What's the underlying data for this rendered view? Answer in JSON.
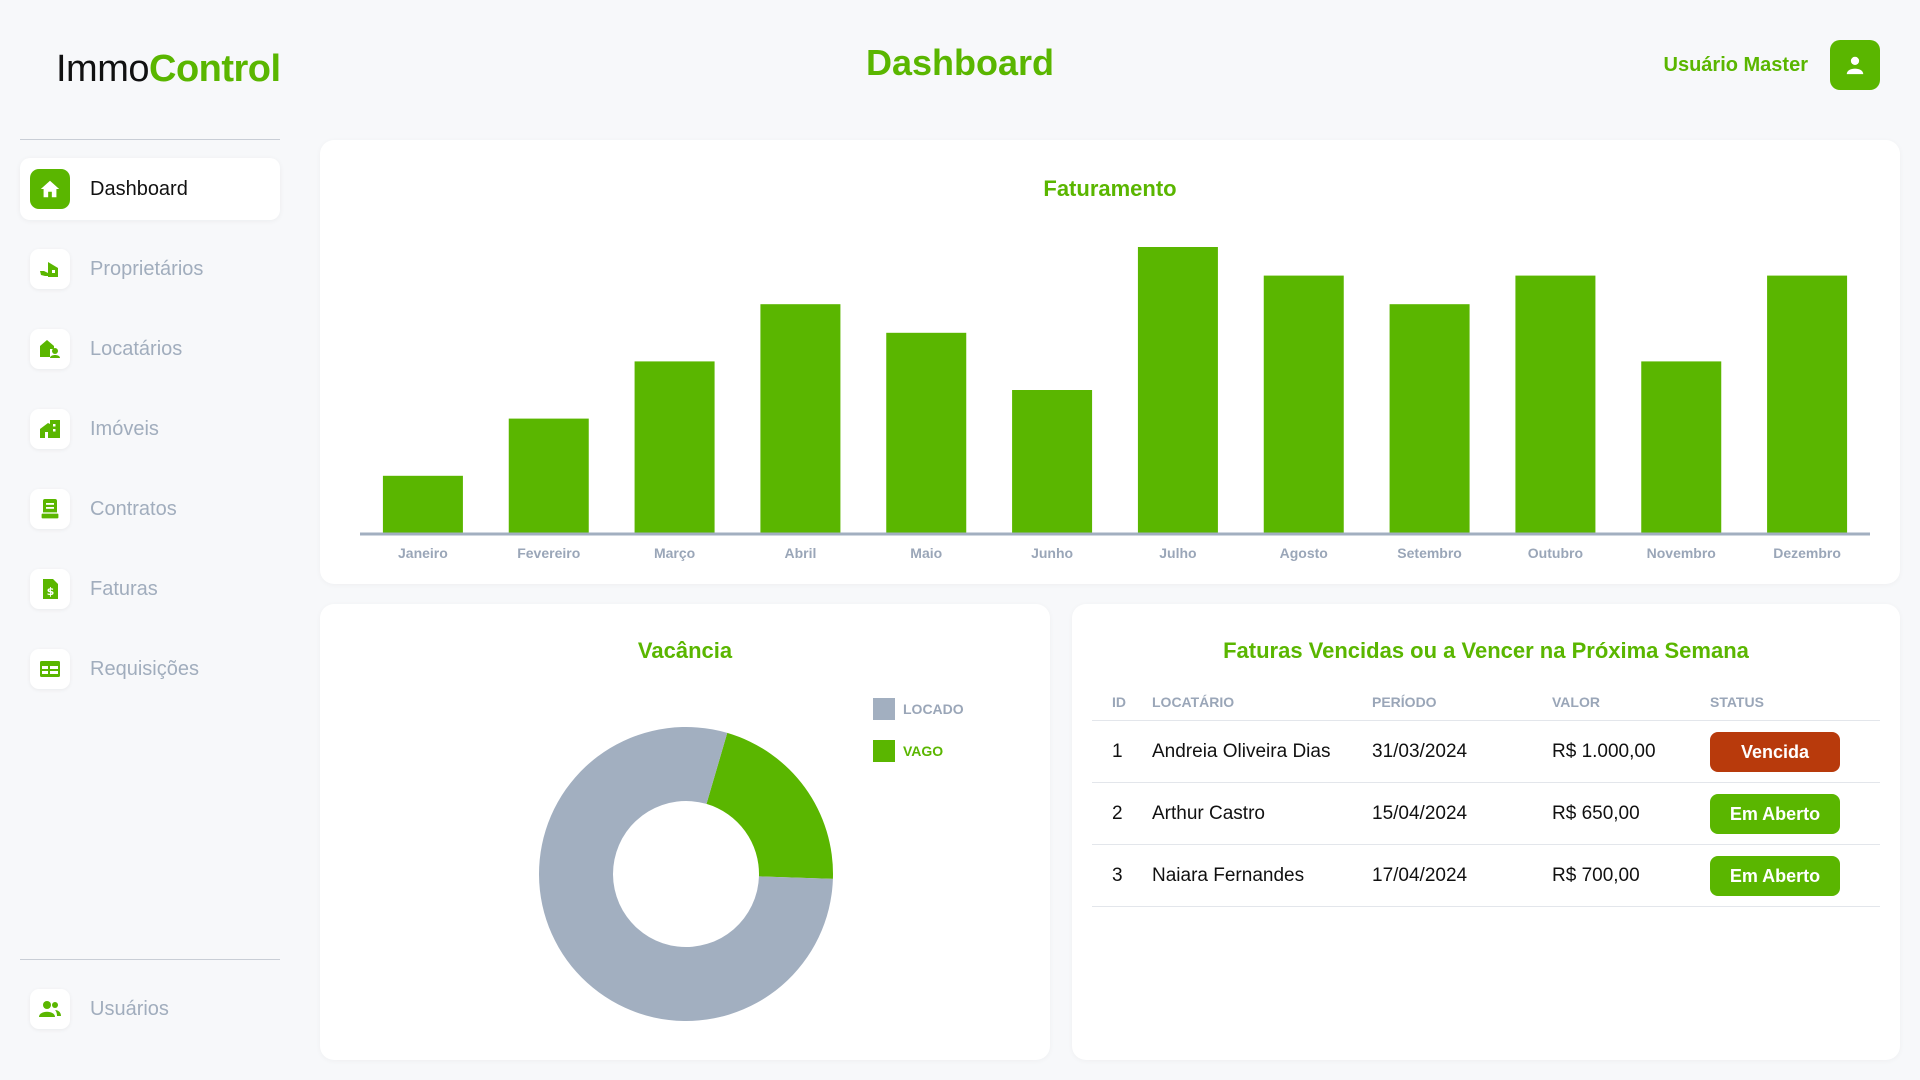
{
  "brand": {
    "part1": "Immo",
    "part2": "Control"
  },
  "header": {
    "title": "Dashboard",
    "user_name": "Usuário Master"
  },
  "nav": {
    "items": [
      {
        "label": "Dashboard",
        "icon": "home-icon",
        "active": true
      },
      {
        "label": "Proprietários",
        "icon": "owner-house-icon",
        "active": false
      },
      {
        "label": "Locatários",
        "icon": "tenant-icon",
        "active": false
      },
      {
        "label": "Imóveis",
        "icon": "building-icon",
        "active": false
      },
      {
        "label": "Contratos",
        "icon": "contract-icon",
        "active": false
      },
      {
        "label": "Faturas",
        "icon": "invoice-dollar-icon",
        "active": false
      },
      {
        "label": "Requisições",
        "icon": "table-list-icon",
        "active": false
      }
    ],
    "bottom": {
      "label": "Usuários",
      "icon": "users-icon"
    }
  },
  "faturamento": {
    "title": "Faturamento",
    "chart_data": {
      "type": "bar",
      "categories": [
        "Janeiro",
        "Fevereiro",
        "Março",
        "Abril",
        "Maio",
        "Junho",
        "Julho",
        "Agosto",
        "Setembro",
        "Outubro",
        "Novembro",
        "Dezembro"
      ],
      "values": [
        2,
        4,
        6,
        8,
        7,
        5,
        10,
        9,
        8,
        9,
        6,
        9
      ],
      "ylim": [
        0,
        10
      ],
      "grid": false,
      "color": "#5ab600"
    }
  },
  "vacancia": {
    "title": "Vacância",
    "chart_data": {
      "type": "pie",
      "donut": true,
      "labels": [
        "LOCADO",
        "VAGO"
      ],
      "values": [
        79,
        21
      ],
      "colors": [
        "#a2afc0",
        "#5ab600"
      ],
      "legend": "top-right"
    }
  },
  "faturas": {
    "title": "Faturas Vencidas ou a Vencer na Próxima Semana",
    "columns": [
      "ID",
      "LOCATÁRIO",
      "PERÍODO",
      "VALOR",
      "STATUS"
    ],
    "rows": [
      {
        "id": "1",
        "locatario": "Andreia Oliveira Dias",
        "periodo": "31/03/2024",
        "valor": "R$ 1.000,00",
        "status": "Vencida",
        "status_color": "#b83a0c"
      },
      {
        "id": "2",
        "locatario": "Arthur Castro",
        "periodo": "15/04/2024",
        "valor": "R$ 650,00",
        "status": "Em Aberto",
        "status_color": "#5ab600"
      },
      {
        "id": "3",
        "locatario": "Naiara Fernandes",
        "periodo": "17/04/2024",
        "valor": "R$ 700,00",
        "status": "Em Aberto",
        "status_color": "#5ab600"
      }
    ]
  },
  "colors": {
    "accent": "#5ab600",
    "muted": "#a2afc0",
    "danger": "#b83a0c"
  }
}
